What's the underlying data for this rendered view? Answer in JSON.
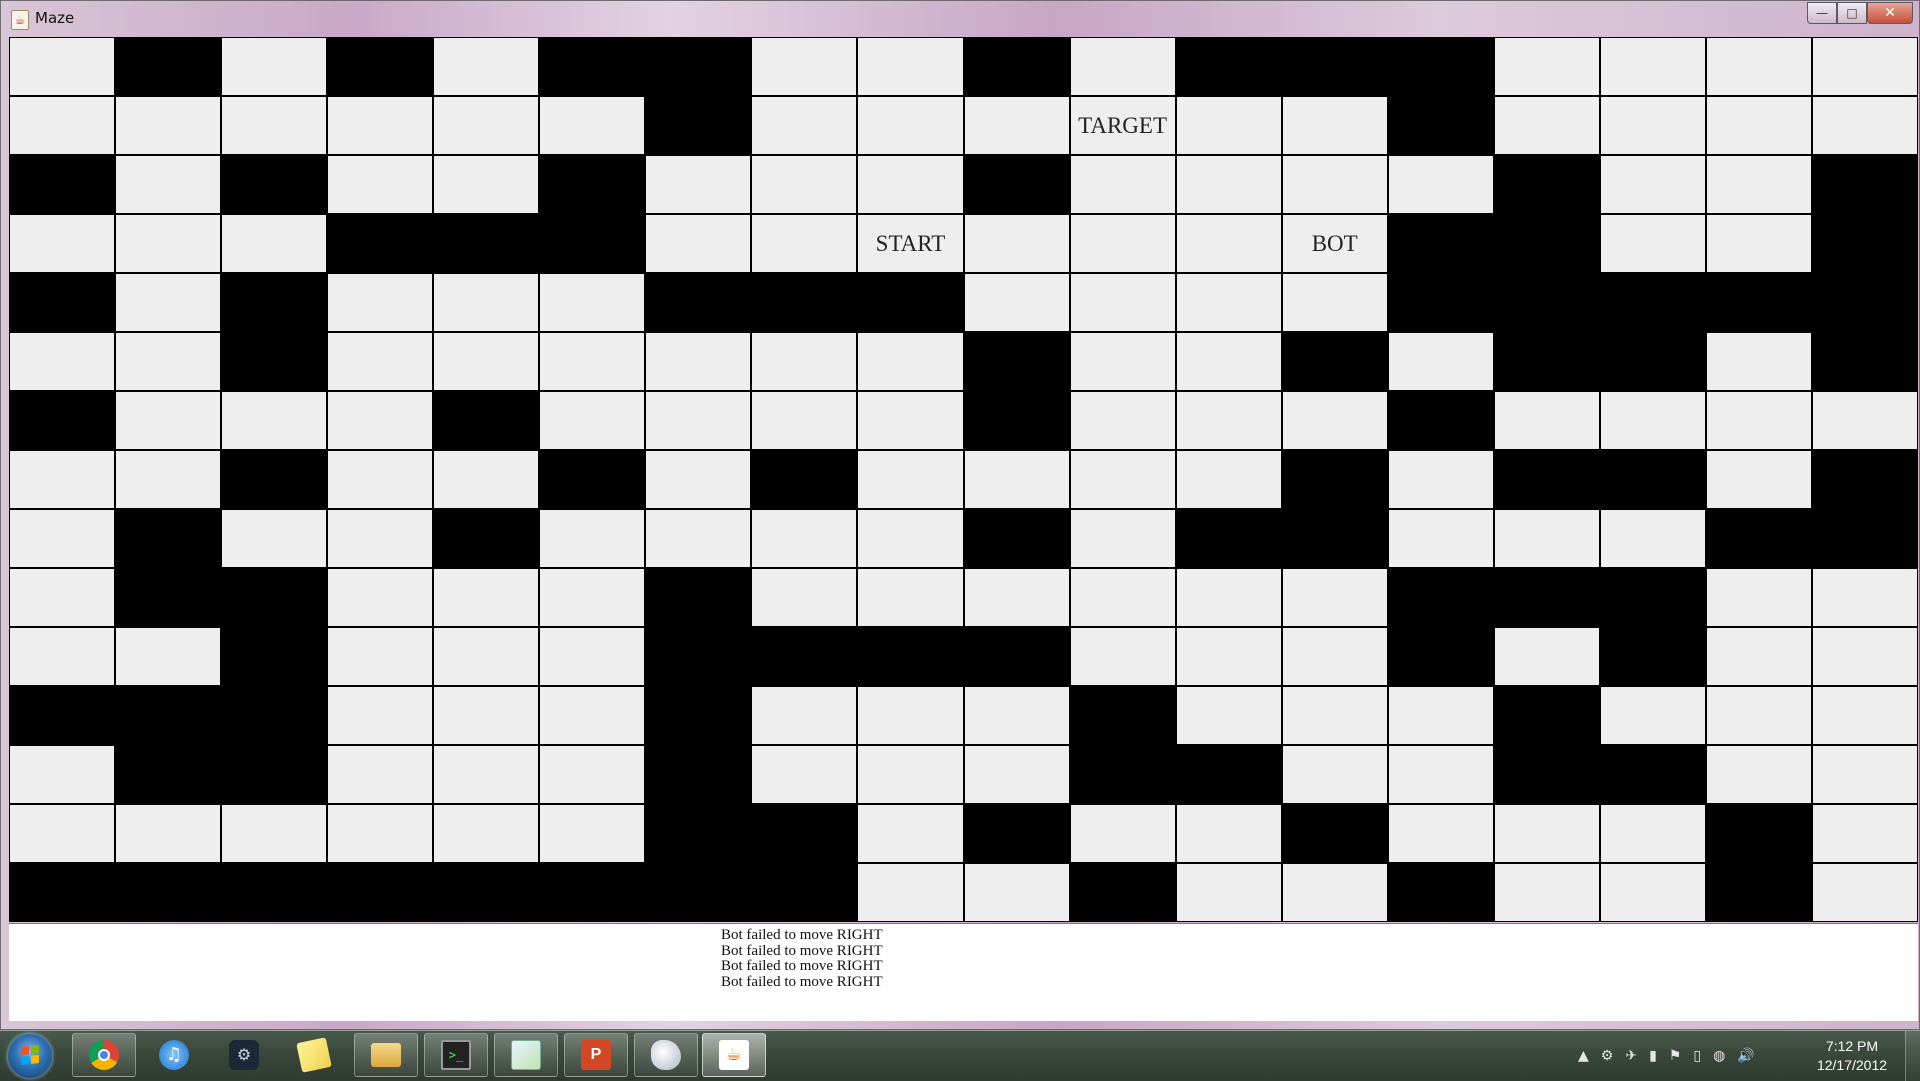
{
  "window": {
    "title": "Maze",
    "minimize_glyph": "—",
    "maximize_glyph": "□",
    "close_glyph": "✕"
  },
  "maze": {
    "columns": 18,
    "rows": 15,
    "grid": [
      "0101011001011100",
      "000000100000010000",
      "101001000100001001",
      "000111000000011001",
      "101000111000011111",
      "001000000100101101",
      "100010000100010000",
      "001001010000101101",
      "010010000101100011",
      "011000100000011100",
      "001000111100010100",
      "111000100010001000",
      "011000100011001100",
      "000000110100100010",
      "111111110010010010"
    ],
    "labels": [
      {
        "row": 1,
        "col": 10,
        "text": "TARGET"
      },
      {
        "row": 3,
        "col": 8,
        "text": "START"
      },
      {
        "row": 3,
        "col": 12,
        "text": "BOT"
      }
    ]
  },
  "log": {
    "lines": [
      "Bot failed to move RIGHT",
      "Bot failed to move RIGHT",
      "Bot failed to move RIGHT",
      "Bot failed to move RIGHT"
    ]
  },
  "taskbar": {
    "items": [
      {
        "name": "chrome-icon",
        "glyph": "",
        "style": "g-chrome",
        "state": "pinned-open"
      },
      {
        "name": "itunes-icon",
        "glyph": "♫",
        "style": "g-itunes",
        "state": "pinned"
      },
      {
        "name": "steam-icon",
        "glyph": "⚙",
        "style": "g-steam",
        "state": "pinned"
      },
      {
        "name": "sticky-notes-icon",
        "glyph": "",
        "style": "g-notes",
        "state": "pinned"
      },
      {
        "name": "file-explorer-icon",
        "glyph": "",
        "style": "g-folder",
        "state": "pinned-open"
      },
      {
        "name": "console-icon",
        "glyph": ">_",
        "style": "g-console",
        "state": "pinned-open"
      },
      {
        "name": "paint-icon",
        "glyph": "",
        "style": "g-paint",
        "state": "pinned-open"
      },
      {
        "name": "powerpoint-icon",
        "glyph": "P",
        "style": "g-ppt",
        "state": "pinned-open"
      },
      {
        "name": "bluej-icon",
        "glyph": "",
        "style": "g-bird",
        "state": "pinned-open"
      },
      {
        "name": "java-icon",
        "glyph": "☕",
        "style": "g-java",
        "state": "active"
      }
    ],
    "tray_icons": [
      "▲",
      "⚙",
      "✈",
      "▮",
      "⚑",
      "▯",
      "◍",
      "🔊"
    ],
    "clock_time": "7:12 PM",
    "clock_date": "12/17/2012"
  }
}
